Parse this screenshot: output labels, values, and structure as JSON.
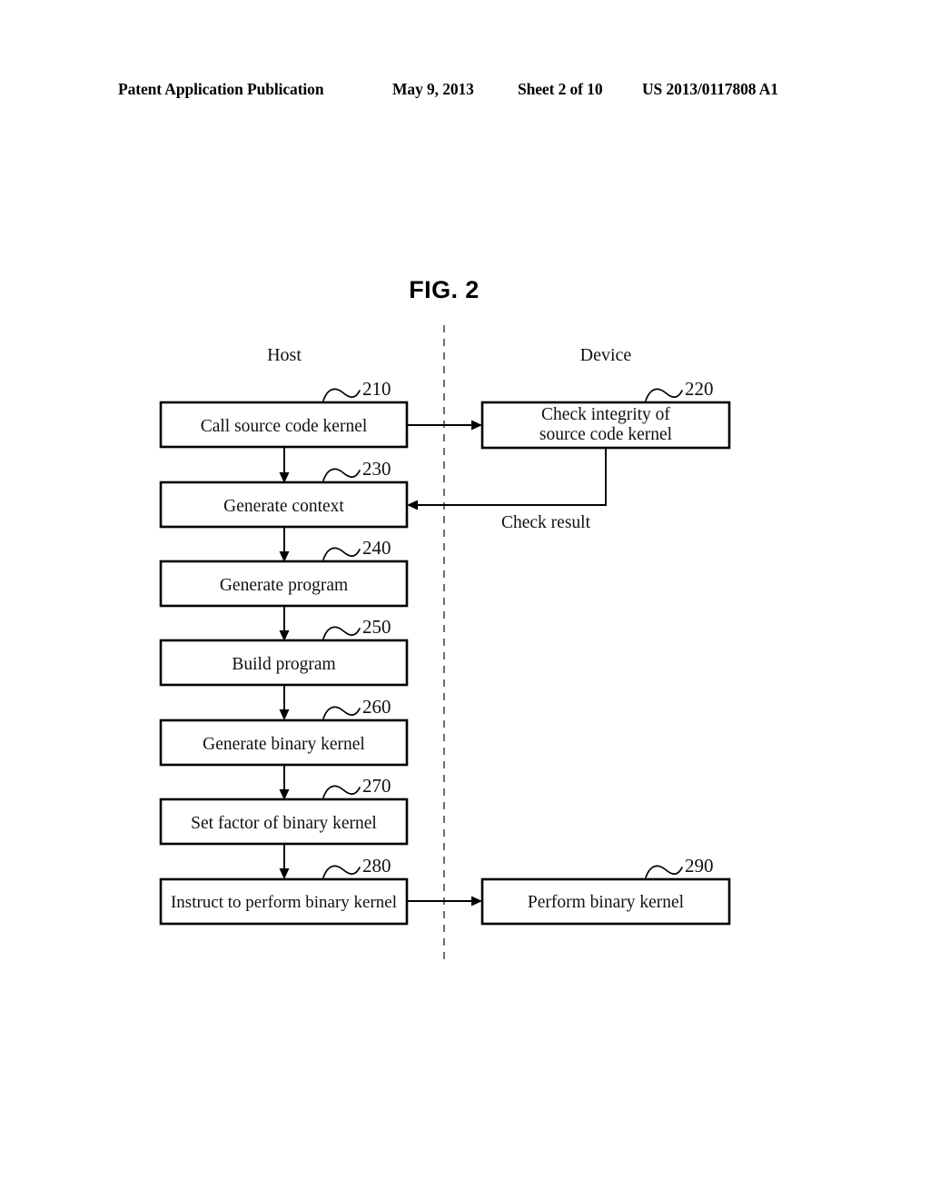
{
  "header": {
    "publication": "Patent Application Publication",
    "date": "May 9, 2013",
    "sheet": "Sheet 2 of 10",
    "patent_number": "US 2013/0117808 A1"
  },
  "figure": {
    "title": "FIG. 2",
    "columns": [
      {
        "label": "Host"
      },
      {
        "label": "Device"
      }
    ],
    "nodes": [
      {
        "ref": "210",
        "label": "Call source code kernel",
        "column": "host"
      },
      {
        "ref": "220",
        "label": "Check integrity of source code kernel",
        "line1": "Check integrity of",
        "line2": "source code kernel",
        "column": "device"
      },
      {
        "ref": "230",
        "label": "Generate context",
        "column": "host"
      },
      {
        "ref": "240",
        "label": "Generate program",
        "column": "host"
      },
      {
        "ref": "250",
        "label": "Build program",
        "column": "host"
      },
      {
        "ref": "260",
        "label": "Generate binary kernel",
        "column": "host"
      },
      {
        "ref": "270",
        "label": "Set factor of binary kernel",
        "column": "host"
      },
      {
        "ref": "280",
        "label": "Instruct to perform binary kernel",
        "column": "host"
      },
      {
        "ref": "290",
        "label": "Perform binary kernel",
        "column": "device"
      }
    ],
    "edge_labels": [
      {
        "label": "Check result"
      }
    ]
  }
}
